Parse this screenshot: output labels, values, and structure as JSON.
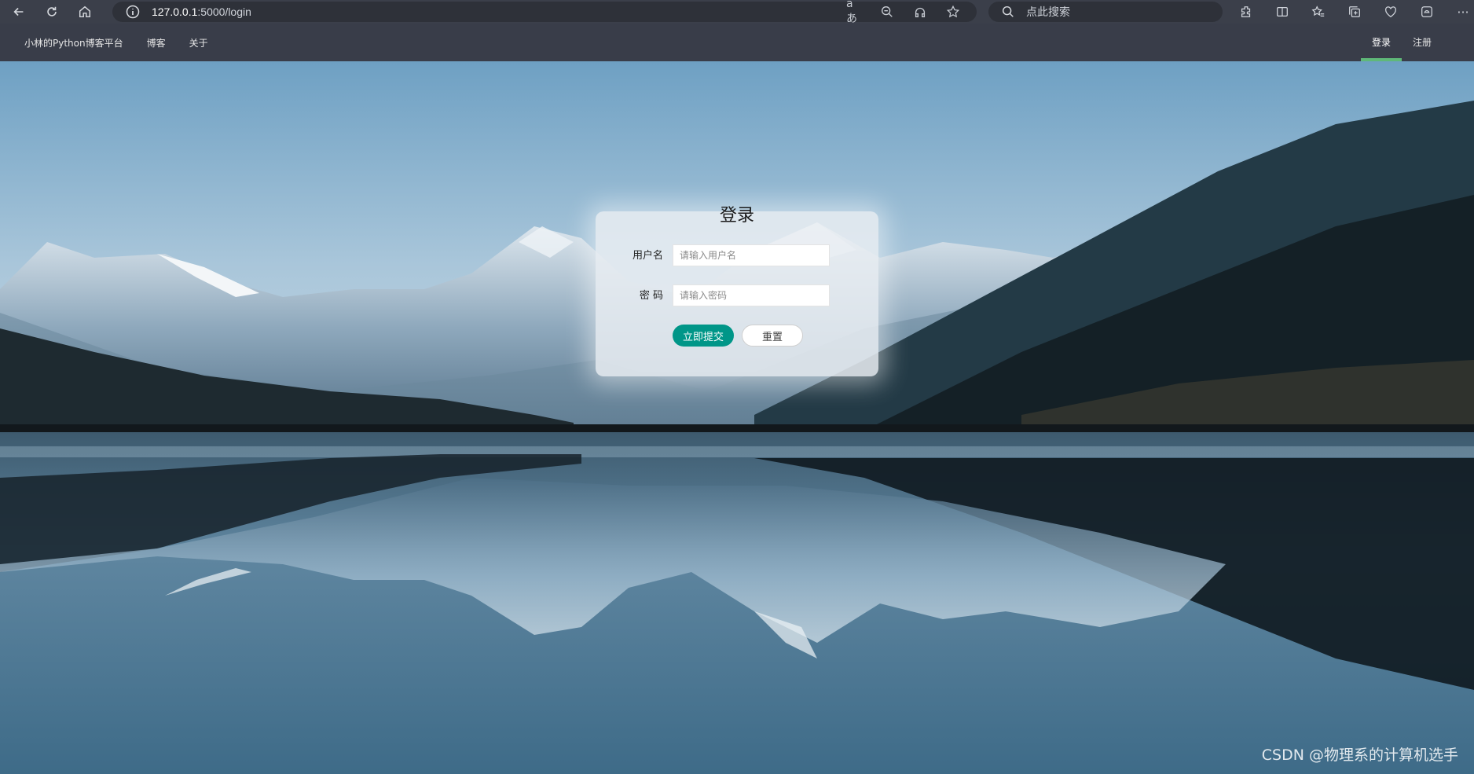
{
  "browser": {
    "url_host": "127.0.0.1",
    "url_path": ":5000/login",
    "search_placeholder": "点此搜索"
  },
  "navbar": {
    "brand": "小林的Python博客平台",
    "items": [
      {
        "label": "博客"
      },
      {
        "label": "关于"
      }
    ],
    "right_items": [
      {
        "label": "登录",
        "active": true
      },
      {
        "label": "注册",
        "active": false
      }
    ]
  },
  "login": {
    "title": "登录",
    "username_label": "用户名",
    "username_placeholder": "请输入用户名",
    "password_label": "密 码",
    "password_placeholder": "请输入密码",
    "submit_label": "立即提交",
    "reset_label": "重置"
  },
  "watermark": "CSDN @物理系的计算机选手",
  "colors": {
    "nav_bg": "#393d49",
    "accent_green": "#009688",
    "active_underline": "#5fb878"
  }
}
